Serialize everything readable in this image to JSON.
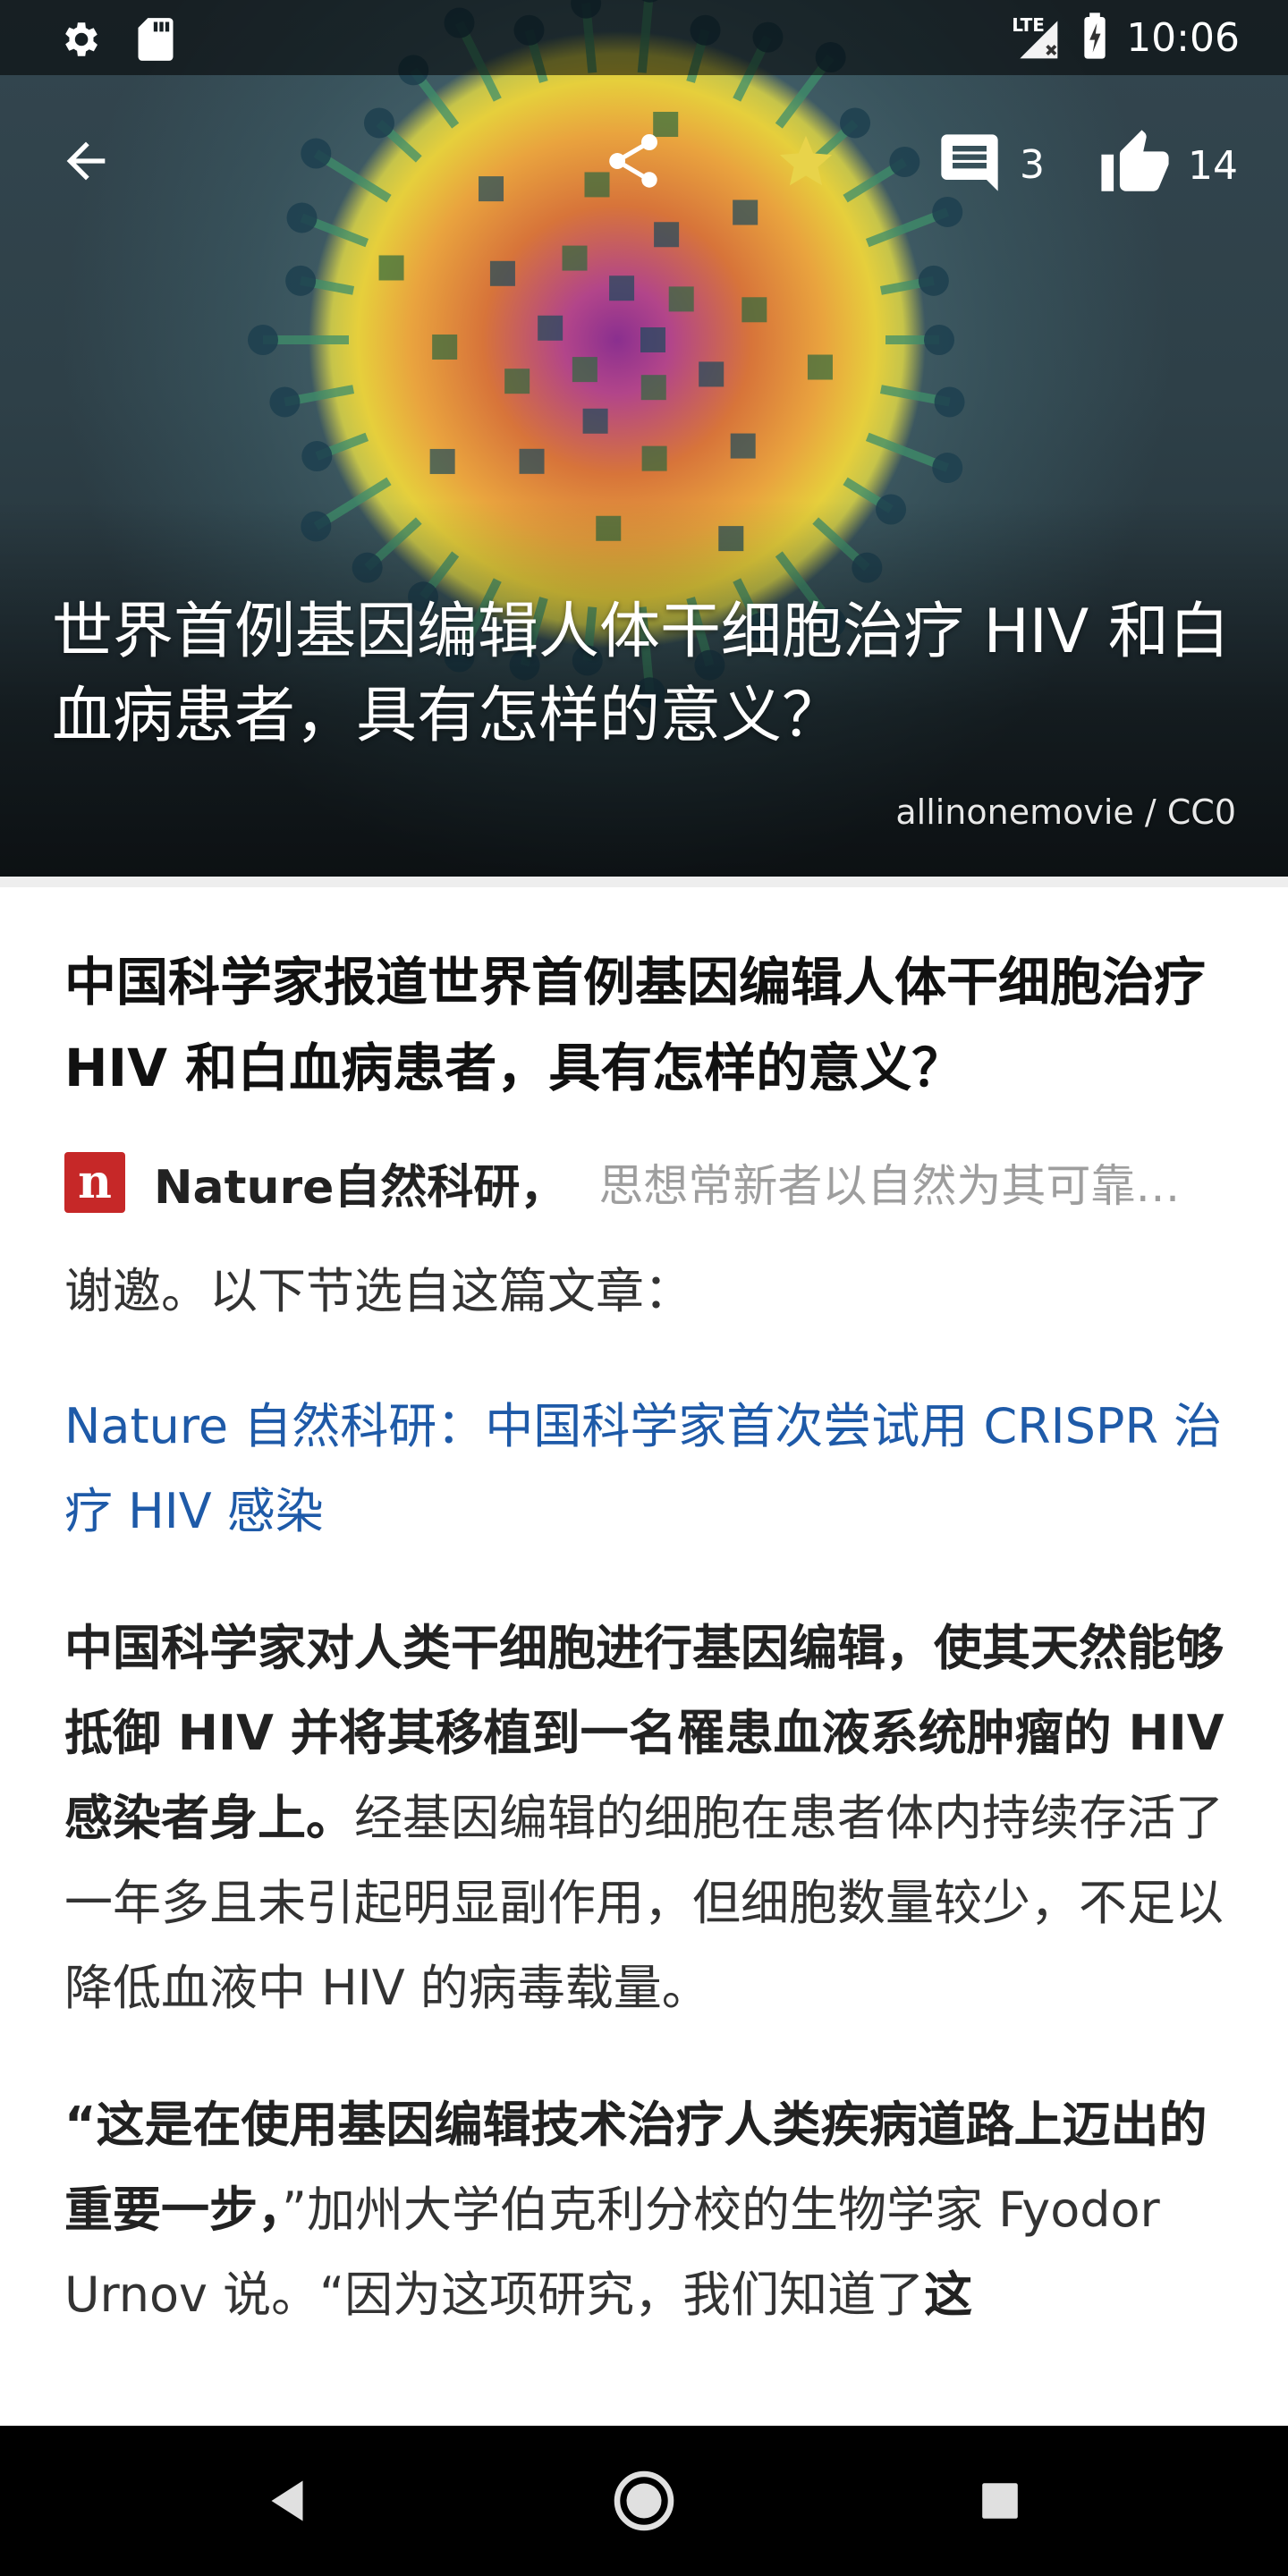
{
  "status_bar": {
    "time": "10:06",
    "network": "LTE",
    "icons": [
      "gear-icon",
      "sd-card-icon",
      "signal-icon",
      "battery-charging-icon"
    ]
  },
  "toolbar": {
    "comment_count": "3",
    "like_count": "14",
    "icons": [
      "back-arrow-icon",
      "share-icon",
      "star-icon",
      "comment-icon",
      "thumb-up-icon"
    ]
  },
  "hero": {
    "title": "世界首例基因编辑人体干细胞治疗 HIV 和白血病患者，具有怎样的意义？",
    "credit": "allinonemovie / CC0"
  },
  "article": {
    "question_title": "中国科学家报道世界首例基因编辑人体干细胞治疗 HIV 和白血病患者，具有怎样的意义？",
    "author": {
      "logo_letter": "n",
      "name": "Nature自然科研，",
      "bio": "思想常新者以自然为其可靠…"
    },
    "intro": "谢邀。以下节选自这篇文章：",
    "link_text": "Nature 自然科研：中国科学家首次尝试用 CRISPR 治疗 HIV 感染",
    "body1_bold": "中国科学家对人类干细胞进行基因编辑，使其天然能够抵御 HIV 并将其移植到一名罹患血液系统肿瘤的 HIV 感染者身上。",
    "body1_rest": "经基因编辑的细胞在患者体内持续存活了一年多且未引起明显副作用，但细胞数量较少，不足以降低血液中 HIV 的病毒载量。",
    "body2_bold": "“这是在使用基因编辑技术治疗人类疾病道路上迈出的重要一步，",
    "body2_rest": "”加州大学伯克利分校的生物学家 Fyodor Urnov 说。“因为这项研究，我们知道了",
    "body2_bold_tail": "这"
  },
  "nav_bar": {
    "icons": [
      "back-triangle-icon",
      "home-circle-icon",
      "recents-square-icon"
    ]
  },
  "colors": {
    "link": "#1e5aa8",
    "author_logo_bg": "#c62828",
    "muted_text": "#9e9e9e",
    "nav_bar_bg": "#000000"
  }
}
